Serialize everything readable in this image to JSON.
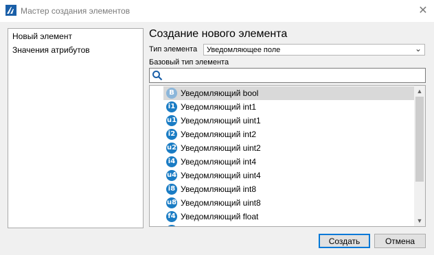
{
  "window": {
    "title": "Мастер создания элементов",
    "close_icon": "close-icon"
  },
  "left_panel": {
    "items": [
      "Новый элемент",
      "Значения атрибутов"
    ]
  },
  "main": {
    "heading": "Создание нового элемента",
    "type_label": "Тип элемента",
    "type_value": "Уведомляющее поле",
    "base_label": "Базовый тип элемента",
    "search_value": "",
    "list": [
      {
        "badge": "B",
        "label": "Уведомляющий bool",
        "selected": true
      },
      {
        "badge": "i1",
        "label": "Уведомляющий int1"
      },
      {
        "badge": "u1",
        "label": "Уведомляющий uint1"
      },
      {
        "badge": "i2",
        "label": "Уведомляющий int2"
      },
      {
        "badge": "u2",
        "label": "Уведомляющий uint2"
      },
      {
        "badge": "i4",
        "label": "Уведомляющий int4"
      },
      {
        "badge": "u4",
        "label": "Уведомляющий uint4"
      },
      {
        "badge": "i8",
        "label": "Уведомляющий int8"
      },
      {
        "badge": "u8",
        "label": "Уведомляющий uint8"
      },
      {
        "badge": "f4",
        "label": "Уведомляющий float"
      }
    ]
  },
  "buttons": {
    "create": "Создать",
    "cancel": "Отмена"
  },
  "colors": {
    "accent": "#0078d7",
    "badge": "#1a7cc4",
    "selected_row": "#d9d9d9"
  }
}
